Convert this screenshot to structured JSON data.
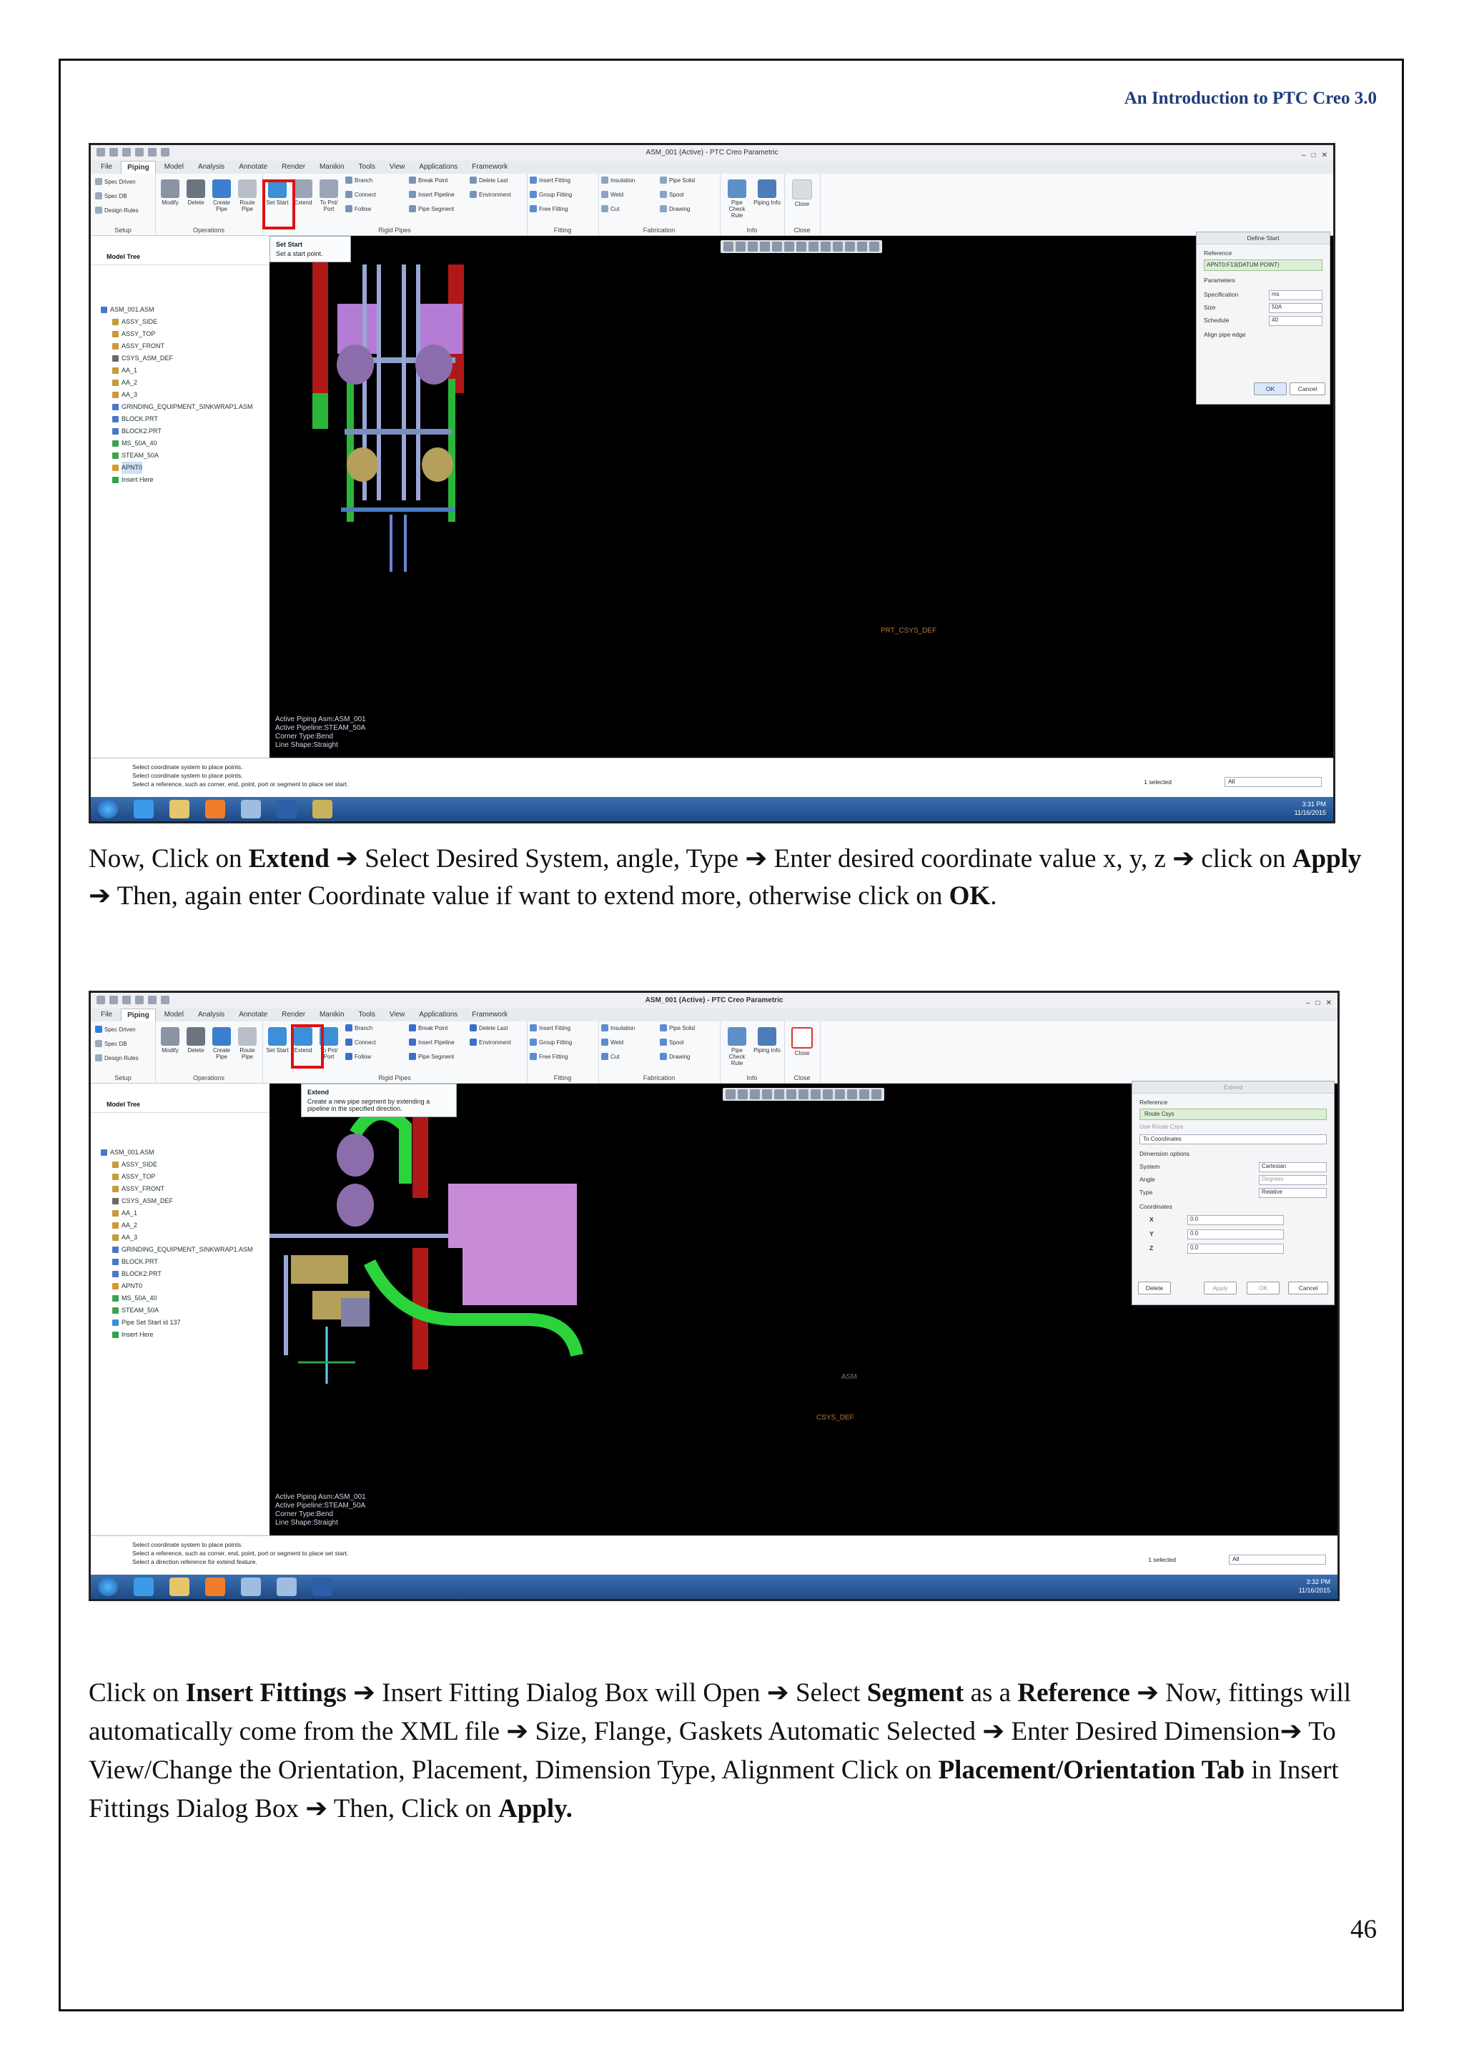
{
  "header": "An Introduction to PTC Creo 3.0",
  "page_number": "46",
  "paragraph1": {
    "t1": "Now, Click on ",
    "b1": "Extend",
    "t2": " ➔ Select Desired System, angle, Type ➔ Enter desired coordinate value x, y, z ➔ click on ",
    "b2": "Apply",
    "t3": " ➔ Then, again enter Coordinate value if want to extend more, otherwise click on ",
    "b3": "OK",
    "t4": "."
  },
  "paragraph2": {
    "t1": "Click on ",
    "b1": "Insert Fittings",
    "t2": " ➔ Insert Fitting Dialog Box will Open ➔ Select ",
    "b2": "Segment",
    "t3": " as a ",
    "b3": "Reference",
    "t4": " ➔ Now, fittings will automatically come from the XML file ➔ Size, Flange, Gaskets Automatic Selected ➔ Enter Desired Dimension➔ To View/Change the Orientation, Placement, Dimension Type, Alignment Click on ",
    "b4": "Placement/Orientation Tab",
    "t5": " in Insert Fittings Dialog Box ➔ Then, Click on ",
    "b5": "Apply."
  },
  "screenshot1": {
    "window_title": "ASM_001 (Active) - PTC Creo Parametric",
    "tabs": [
      "File",
      "Piping",
      "Model",
      "Analysis",
      "Annotate",
      "Render",
      "Manikin",
      "Tools",
      "View",
      "Applications",
      "Framework"
    ],
    "ribbon_groups": {
      "setup": "Setup",
      "operations": "Operations",
      "rigid_pipes": "Rigid Pipes",
      "fitting": "Fitting",
      "fabrication": "Fabrication",
      "info": "Info",
      "close": "Close"
    },
    "setup_items": [
      "Spec Driven",
      "Spec DB",
      "Design Rules"
    ],
    "operations_buttons": [
      "Modify",
      "Delete",
      "Create Pipe",
      "Route Pipe"
    ],
    "rigid_buttons": [
      "Set Start",
      "Extend",
      "To Pnt/ Port"
    ],
    "rigid_items": [
      "Branch",
      "Break Point",
      "Delete Last",
      "Connect",
      "Insert Pipeline",
      "Environment",
      "Follow",
      "Pipe Segment"
    ],
    "fitting_items": [
      "Insert Fitting",
      "Group Fitting",
      "Free Fitting"
    ],
    "fabrication_items": [
      "Insulation",
      "Pipe Solid",
      "Weld",
      "Spool",
      "Cut",
      "Drawing"
    ],
    "info_buttons": [
      "Pipe Check Rule",
      "Piping Info"
    ],
    "close_label": "Close",
    "model_tree_label": "Model Tree",
    "tree_items": [
      "ASM_001.ASM",
      "ASSY_SIDE",
      "ASSY_TOP",
      "ASSY_FRONT",
      "CSYS_ASM_DEF",
      "AA_1",
      "AA_2",
      "AA_3",
      "GRINDING_EQUIPMENT_SINKWRAP1.ASM",
      "BLOCK.PRT",
      "BLOCK2.PRT",
      "MS_50A_40",
      "STEAM_50A",
      "APNT0",
      "Insert Here"
    ],
    "tooltip_title": "Set Start",
    "tooltip_text": "Set a start point.",
    "dialog": {
      "title": "Define Start",
      "reference_label": "Reference",
      "reference_value": "APNT0:F13(DATUM POINT)",
      "parameters_label": "Parameters",
      "spec_label": "Specification",
      "spec_value": "ms",
      "size_label": "Size",
      "size_value": "50A",
      "schedule_label": "Schedule",
      "schedule_value": "40",
      "align_label": "Align pipe edge",
      "ok": "OK",
      "cancel": "Cancel"
    },
    "overlay_lines": [
      "Active Piping Asm:ASM_001",
      "Active Pipeline:STEAM_50A",
      "Corner Type:Bend",
      "Line Shape:Straight"
    ],
    "csys_label": "PRT_CSYS_DEF",
    "messages": [
      "Select coordinate system to place points.",
      "Select coordinate system to place points.",
      "Select a reference, such as corner, end, point, port or segment to place set start."
    ],
    "selected": "1 selected",
    "filter": "All",
    "clock_time": "3:31 PM",
    "clock_date": "11/16/2015"
  },
  "screenshot2": {
    "window_title": "ASM_001 (Active) - PTC Creo Parametric",
    "tree_items": [
      "ASM_001.ASM",
      "ASSY_SIDE",
      "ASSY_TOP",
      "ASSY_FRONT",
      "CSYS_ASM_DEF",
      "AA_1",
      "AA_2",
      "AA_3",
      "GRINDING_EQUIPMENT_SINKWRAP1.ASM",
      "BLOCK.PRT",
      "BLOCK2.PRT",
      "APNT0",
      "MS_50A_40",
      "STEAM_50A",
      "Pipe Set Start id 137",
      "Insert Here"
    ],
    "tooltip_title": "Extend",
    "tooltip_text": "Create a new pipe segment by extending a pipeline in the specified direction.",
    "dialog": {
      "title": "Extend",
      "reference_label": "Reference",
      "reference_value": "Route Csys",
      "use_route_csys": "Use Route Csys",
      "to_coordinates": "To Coordinates",
      "dimension_options": "Dimension options",
      "system_label": "System",
      "system_value": "Cartesian",
      "angle_label": "Angle",
      "angle_value": "Degrees",
      "type_label": "Type",
      "type_value": "Relative",
      "coordinates_label": "Coordinates",
      "x_label": "X",
      "x_value": "0.0",
      "y_label": "Y",
      "y_value": "0.0",
      "z_label": "Z",
      "z_value": "0.0",
      "delete": "Delete",
      "apply": "Apply",
      "ok": "OK",
      "cancel": "Cancel"
    },
    "overlay_lines": [
      "Active Piping Asm:ASM_001",
      "Active Pipeline:STEAM_50A",
      "Corner Type:Bend",
      "Line Shape:Straight"
    ],
    "csys_label": "CSYS_DEF",
    "asm_label": "ASM",
    "messages": [
      "Select coordinate system to place points.",
      "Select a reference, such as corner, end, point, port or segment to place set start.",
      "Select a direction reference for extend feature."
    ],
    "selected": "1 selected",
    "filter": "All",
    "clock_time": "3:32 PM",
    "clock_date": "11/16/2015"
  }
}
